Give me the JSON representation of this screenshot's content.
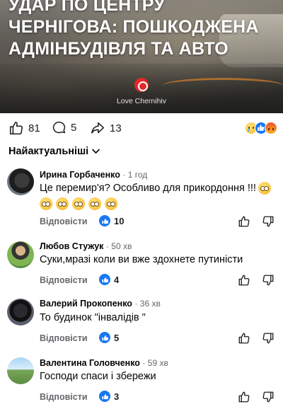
{
  "post": {
    "headline_lines": [
      "УДАР ПО ЦЕНТРУ",
      "ЧЕРНІГОВА: ПОШКОДЖЕНА",
      "АДМІНБУДІВЛЯ ТА АВТО"
    ],
    "brand_name": "Love Chernihiv"
  },
  "stats": {
    "likes": "81",
    "comments": "5",
    "shares": "13",
    "reaction_icons": [
      "sad-emoji-icon",
      "like-reaction-icon",
      "angry-emoji-icon"
    ]
  },
  "sort": {
    "label": "Найактуальніші"
  },
  "labels": {
    "reply": "Відповісти"
  },
  "comments": [
    {
      "author": "Ирина Горбаченко",
      "time": "1 год",
      "text": "Це перемир'я? Особливо для прикордоння !!!",
      "emoji_count": 6,
      "likes": "10"
    },
    {
      "author": "Любов Стужук",
      "time": "50 хв",
      "text": "Суки,мразі коли ви вже здохнете путиністи",
      "likes": "4"
    },
    {
      "author": "Валерий Прокопенко",
      "time": "36 хв",
      "text": "То будинок \"інвалідів \"",
      "likes": "5"
    },
    {
      "author": "Валентина Головченко",
      "time": "59 хв",
      "text": "Господи спаси і збережи",
      "likes": "3"
    }
  ],
  "colors": {
    "accent": "#1877f2",
    "muted": "#65676b",
    "brand": "#e3282b"
  }
}
